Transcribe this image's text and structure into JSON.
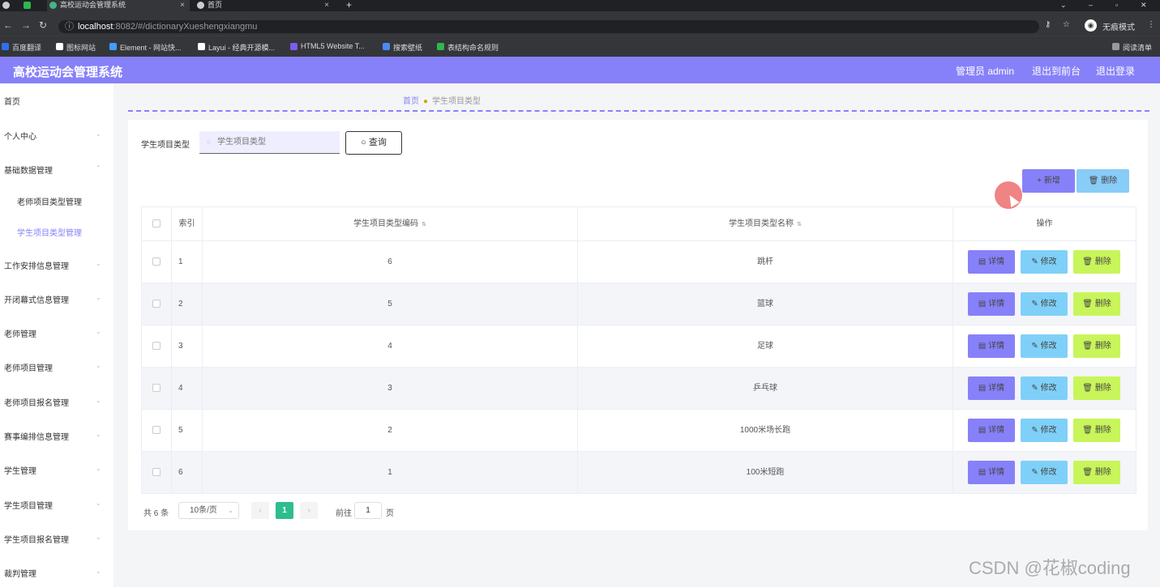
{
  "browser": {
    "tabs": [
      {
        "label": ""
      },
      {
        "label": ""
      },
      {
        "label": "高校运动会管理系统"
      },
      {
        "label": "首页"
      }
    ],
    "url_host": "localhost",
    "url_rest": ":8082/#/dictionaryXueshengxiangmu",
    "incognito_label": "无痕模式",
    "bookmarks": [
      "百度翻译",
      "图标网站",
      "Element - 网站快...",
      "Layui - 经典开源模...",
      "HTML5 Website T...",
      "搜索壁纸",
      "表结构命名规则"
    ],
    "reading_list": "阅读清单"
  },
  "header": {
    "title": "高校运动会管理系统",
    "user": "管理员 admin",
    "exit_front": "退出到前台",
    "logout": "退出登录",
    "accent_color": "#8781f9"
  },
  "sidebar": {
    "items": [
      {
        "label": "首页"
      },
      {
        "label": "个人中心"
      },
      {
        "label": "基础数据管理"
      },
      {
        "label": "老师项目类型管理"
      },
      {
        "label": "学生项目类型管理"
      },
      {
        "label": "工作安排信息管理"
      },
      {
        "label": "开闭幕式信息管理"
      },
      {
        "label": "老师管理"
      },
      {
        "label": "老师项目管理"
      },
      {
        "label": "老师项目报名管理"
      },
      {
        "label": "赛事编排信息管理"
      },
      {
        "label": "学生管理"
      },
      {
        "label": "学生项目管理"
      },
      {
        "label": "学生项目报名管理"
      },
      {
        "label": "裁判管理"
      }
    ]
  },
  "breadcrumb": {
    "home": "首页",
    "current": "学生项目类型"
  },
  "search": {
    "label": "学生项目类型",
    "placeholder": "学生项目类型",
    "query_label": "查询"
  },
  "actions": {
    "add_label": "新增",
    "delete_label": "删除"
  },
  "table": {
    "headers": {
      "index": "索引",
      "code": "学生项目类型编码",
      "name": "学生项目类型名称",
      "ops": "操作"
    },
    "row_buttons": {
      "detail": "详情",
      "edit": "修改",
      "delete": "删除"
    },
    "rows": [
      {
        "index": "1",
        "code": "6",
        "name": "跳杆"
      },
      {
        "index": "2",
        "code": "5",
        "name": "篮球"
      },
      {
        "index": "3",
        "code": "4",
        "name": "足球"
      },
      {
        "index": "4",
        "code": "3",
        "name": "乒乓球"
      },
      {
        "index": "5",
        "code": "2",
        "name": "1000米场长跑"
      },
      {
        "index": "6",
        "code": "1",
        "name": "100米短跑"
      }
    ]
  },
  "pagination": {
    "total": "共 6 条",
    "page_size": "10条/页",
    "current": "1",
    "goto_label": "前往",
    "goto_value": "1",
    "unit": "页"
  },
  "watermark": "CSDN @花椒coding"
}
